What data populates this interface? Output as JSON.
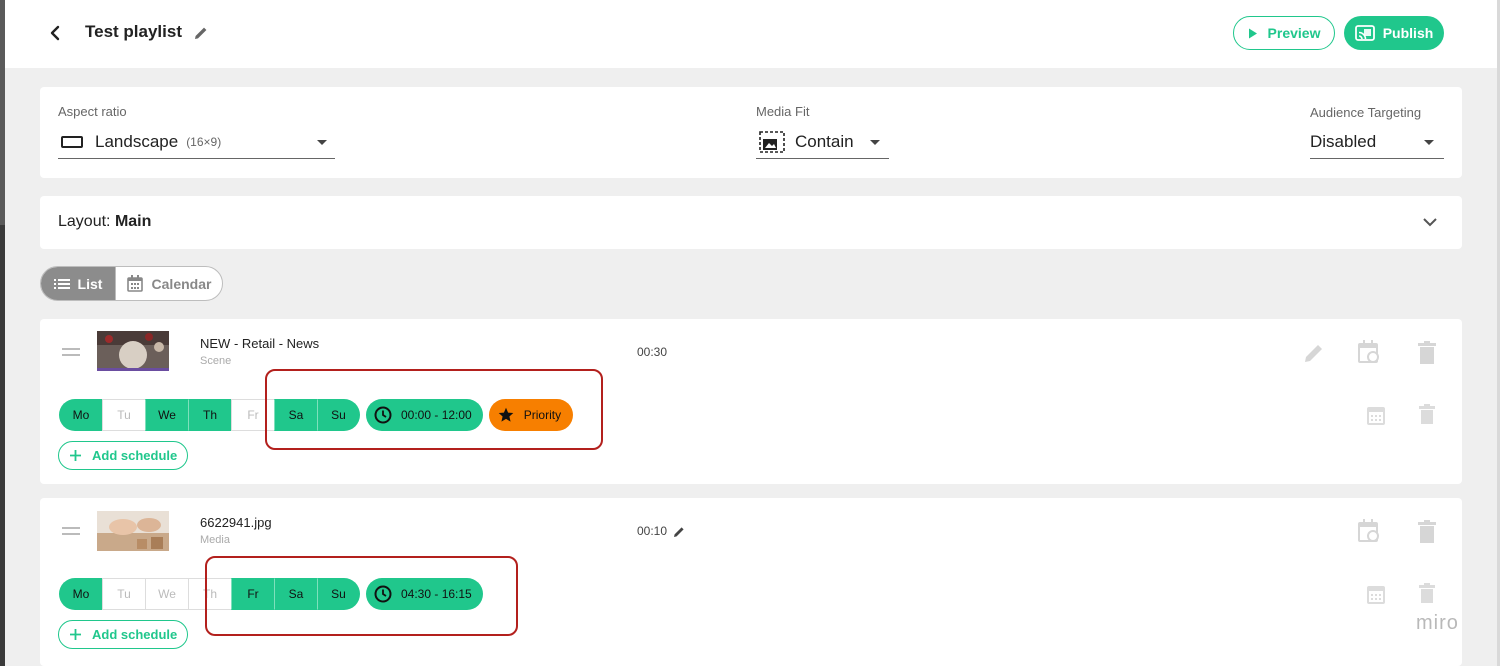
{
  "header": {
    "title": "Test playlist",
    "preview_label": "Preview",
    "publish_label": "Publish"
  },
  "settings": {
    "aspect_ratio": {
      "label": "Aspect ratio",
      "value": "Landscape",
      "detail": "(16×9)"
    },
    "media_fit": {
      "label": "Media Fit",
      "value": "Contain"
    },
    "audience": {
      "label": "Audience Targeting",
      "value": "Disabled"
    }
  },
  "layout": {
    "prefix": "Layout:",
    "name": "Main"
  },
  "view_toggle": {
    "list_label": "List",
    "calendar_label": "Calendar",
    "active": "List"
  },
  "items": [
    {
      "name": "NEW - Retail - News",
      "type": "Scene",
      "duration": "00:30",
      "schedule": {
        "days": [
          {
            "label": "Mo",
            "active": true
          },
          {
            "label": "Tu",
            "active": false
          },
          {
            "label": "We",
            "active": true
          },
          {
            "label": "Th",
            "active": true
          },
          {
            "label": "Fr",
            "active": false
          },
          {
            "label": "Sa",
            "active": true
          },
          {
            "label": "Su",
            "active": true
          }
        ],
        "time": "00:00 - 12:00",
        "priority": "Priority"
      },
      "add_schedule": "Add schedule"
    },
    {
      "name": "6622941.jpg",
      "type": "Media",
      "duration": "00:10",
      "schedule": {
        "days": [
          {
            "label": "Mo",
            "active": true
          },
          {
            "label": "Tu",
            "active": false
          },
          {
            "label": "We",
            "active": false
          },
          {
            "label": "Th",
            "active": false
          },
          {
            "label": "Fr",
            "active": true
          },
          {
            "label": "Sa",
            "active": true
          },
          {
            "label": "Su",
            "active": true
          }
        ],
        "time": "04:30 - 16:15"
      },
      "add_schedule": "Add schedule"
    }
  ],
  "watermark": "miro",
  "colors": {
    "accent": "#20c78c",
    "priority": "#f77f00",
    "highlight": "#b3201d"
  }
}
